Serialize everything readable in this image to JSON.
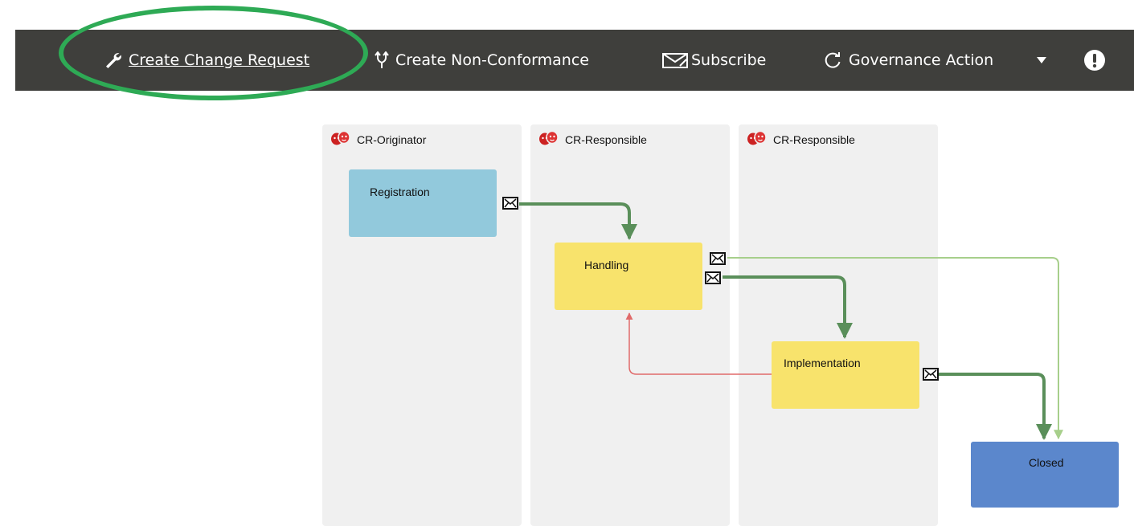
{
  "toolbar": {
    "create_change_request": "Create Change Request",
    "create_non_conformance": "Create Non-Conformance",
    "subscribe": "Subscribe",
    "governance_action": "Governance Action"
  },
  "lanes": [
    {
      "role": "CR-Originator"
    },
    {
      "role": "CR-Responsible"
    },
    {
      "role": "CR-Responsible"
    }
  ],
  "steps": {
    "registration": "Registration",
    "handling": "Handling",
    "implementation": "Implementation",
    "closed": "Closed"
  },
  "icons": {
    "create_change_request": "wrench-icon",
    "create_non_conformance": "fork-icon",
    "subscribe": "envelope-icon",
    "governance_action": "refresh-icon",
    "more": "caret-down-icon",
    "alert": "exclamation-icon",
    "role": "theater-masks-icon",
    "transition": "envelope-icon"
  },
  "colors": {
    "toolbar": "#3f3f3c",
    "highlight": "#2eaa55",
    "lane": "#f0f0f0",
    "registration": "#92c9dc",
    "handling": "#f8e36c",
    "implementation": "#f8e36c",
    "closed": "#5b87cc",
    "flow_main": "#5a8f5a",
    "flow_light": "#a7cf8b",
    "flow_reject": "#e06a6a",
    "role_icon": "#cc2222"
  }
}
